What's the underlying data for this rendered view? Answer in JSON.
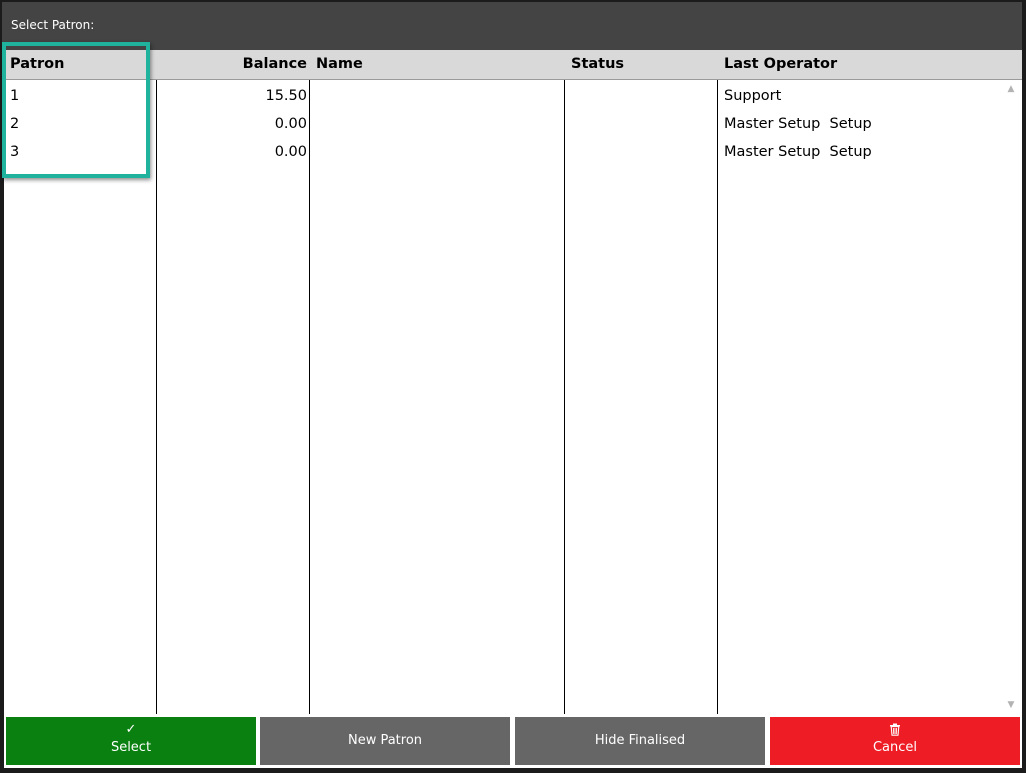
{
  "window": {
    "title": "Select Patron:"
  },
  "grid": {
    "columns": [
      "Patron",
      "Balance",
      "Name",
      "Status",
      "Last Operator"
    ],
    "rows": [
      {
        "patron": "1",
        "balance": "15.50",
        "name": "",
        "status": "",
        "last_operator": "Support"
      },
      {
        "patron": "2",
        "balance": "0.00",
        "name": "",
        "status": "",
        "last_operator": "Master Setup  Setup"
      },
      {
        "patron": "3",
        "balance": "0.00",
        "name": "",
        "status": "",
        "last_operator": "Master Setup  Setup"
      }
    ]
  },
  "scrollbar": {
    "up_icon": "chevron-up-icon",
    "down_icon": "chevron-down-icon"
  },
  "buttons": {
    "select": {
      "label": "Select",
      "icon": "check-icon",
      "color": "#0a8010"
    },
    "new_patron": {
      "label": "New Patron",
      "color": "#666666"
    },
    "hide_finalised": {
      "label": "Hide Finalised",
      "color": "#666666"
    },
    "cancel": {
      "label": "Cancel",
      "icon": "trash-icon",
      "color": "#ee1c25"
    }
  },
  "colors": {
    "titlebar": "#444444",
    "header": "#d9d9d9",
    "highlight": "#1fb29d"
  }
}
